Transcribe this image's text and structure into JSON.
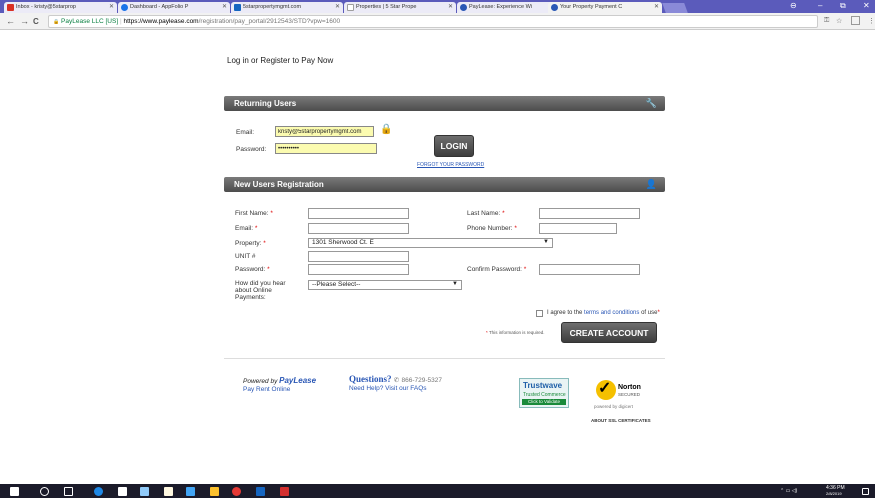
{
  "browser": {
    "tabs": [
      {
        "label": "Inbox - kristy@5starprop",
        "color": "#d93025"
      },
      {
        "label": "Dashboard - AppFolio P",
        "color": "#1a73e8"
      },
      {
        "label": "5starpropertymgmt.com",
        "color": "#1565c0"
      },
      {
        "label": "Properties | 5 Star Prope",
        "color": "#9e9e9e"
      },
      {
        "label": "PayLease: Experience Wi",
        "color": "#2a57b5"
      },
      {
        "label": "Your Property Payment C",
        "color": "#2a57b5"
      }
    ],
    "back": "←",
    "forward": "→",
    "reload": "C",
    "lock_icon": "🔒",
    "security_label": "PayLease LLC [US]",
    "url_host": "https://www.paylease.com",
    "url_path": "/registration/pay_portal/2912543/STD?vpw=1600",
    "window_controls": {
      "account": "⊖",
      "minimize": "–",
      "maximize": "⧉",
      "close": "✕"
    },
    "toolbar_icons": {
      "key": "⚿",
      "star": "☆",
      "menu": "⋮"
    }
  },
  "page": {
    "title": "Log in or Register to Pay Now",
    "returning": {
      "header": "Returning Users",
      "email_label": "Email:",
      "email_value": "kristy@5starpropertymgmt.com",
      "password_label": "Password:",
      "password_value": "••••••••••",
      "login_button": "LOGIN",
      "forgot_link": "FORGOT YOUR PASSWORD"
    },
    "newusers": {
      "header": "New Users Registration",
      "first_name": "First Name:",
      "last_name": "Last Name:",
      "email": "Email:",
      "phone": "Phone Number:",
      "property": "Property:",
      "property_value": "1301 Sherwood Ct. E",
      "unit": "UNIT #",
      "password": "Password:",
      "confirm_password": "Confirm Password:",
      "how_heard_line1": "How did you hear",
      "how_heard_line2": "about Online",
      "how_heard_line3": "Payments:",
      "how_heard_value": "--Please Select--",
      "required_star": "*",
      "agree_prefix": "I agree to the",
      "agree_link": "terms and conditions",
      "agree_suffix": "of use",
      "required_note": "This information is required.",
      "create_button": "CREATE ACCOUNT"
    },
    "footer": {
      "powered_by": "Powered by",
      "brand": "PayLease",
      "pay_rent": "Pay Rent Online",
      "questions": "Questions?",
      "phone": "866-729-5327",
      "help": "Need Help? Visit our FAQs",
      "trustwave_name": "Trustwave",
      "trustwave_sub": "Trusted Commerce",
      "trustwave_click": "Click to Validate",
      "norton_name": "Norton",
      "norton_secured": "SECURED",
      "norton_powered": "powered by digicert",
      "ssl": "ABOUT SSL CERTIFICATES"
    }
  },
  "taskbar": {
    "time": "4:36 PM",
    "date": "2/8/2019",
    "icons": [
      "#ffffff",
      "#ffffff",
      "#ffffff",
      "#1e88e5",
      "#ffffff",
      "#90caf9",
      "#fff8e1",
      "#42a5f5",
      "#fbc02d",
      "#e53935",
      "#1565c0",
      "#d32f2f"
    ]
  }
}
